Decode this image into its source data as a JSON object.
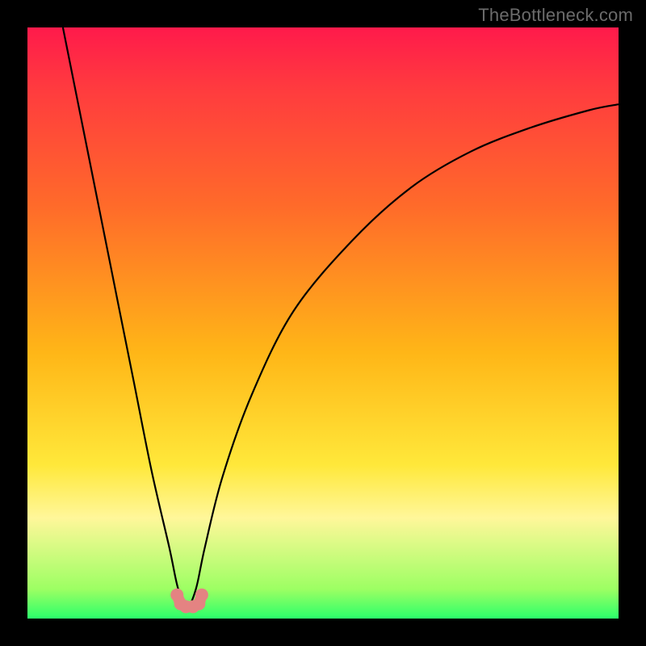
{
  "watermark": "TheBottleneck.com",
  "colors": {
    "frame": "#000000",
    "curve": "#000000",
    "bump": "#e48382",
    "gradient_stops": [
      {
        "pos": 0.0,
        "hex": "#ff1a4b"
      },
      {
        "pos": 0.1,
        "hex": "#ff3a3f"
      },
      {
        "pos": 0.3,
        "hex": "#ff6a2a"
      },
      {
        "pos": 0.55,
        "hex": "#ffb617"
      },
      {
        "pos": 0.74,
        "hex": "#ffe83a"
      },
      {
        "pos": 0.83,
        "hex": "#fff79a"
      },
      {
        "pos": 0.95,
        "hex": "#9dff63"
      },
      {
        "pos": 1.0,
        "hex": "#2bff6a"
      }
    ]
  },
  "chart_data": {
    "type": "line",
    "title": "",
    "xlabel": "",
    "ylabel": "",
    "xlim": [
      0,
      100
    ],
    "ylim": [
      0,
      100
    ],
    "note": "V-shaped bottleneck curve. Minimum near x≈27, y≈2. Left branch steeper than right. Values estimated from pixel positions on a 0–100 relative scale (x left→right, y bottom→top).",
    "series": [
      {
        "name": "bottleneck-curve",
        "x": [
          6,
          10,
          14,
          18,
          21,
          24,
          25.5,
          27,
          28.5,
          30,
          33,
          38,
          45,
          55,
          65,
          75,
          85,
          95,
          100
        ],
        "y": [
          100,
          80,
          60,
          40,
          25,
          12,
          5,
          2,
          5,
          12,
          24,
          38,
          52,
          64,
          73,
          79,
          83,
          86,
          87
        ]
      }
    ],
    "markers": {
      "name": "min-bump",
      "x": [
        25.3,
        25.9,
        26.8,
        28.0,
        29.0,
        29.5
      ],
      "y": [
        4.0,
        2.5,
        2.0,
        2.0,
        2.5,
        4.0
      ]
    }
  }
}
